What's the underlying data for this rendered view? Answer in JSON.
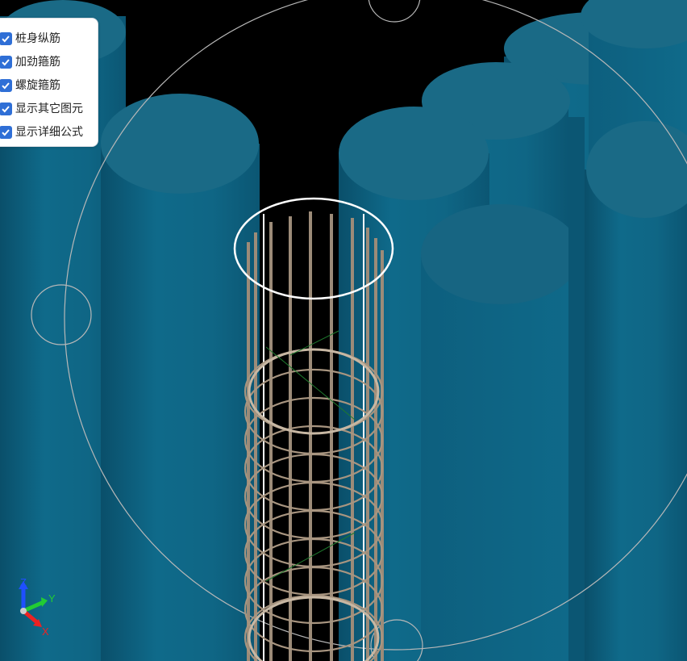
{
  "layer_panel": {
    "items": [
      {
        "label": "桩身纵筋",
        "checked": true
      },
      {
        "label": "加劲箍筋",
        "checked": true
      },
      {
        "label": "螺旋箍筋",
        "checked": true
      },
      {
        "label": "显示其它图元",
        "checked": true
      },
      {
        "label": "显示详细公式",
        "checked": true
      }
    ],
    "check_color": "#2f6fd6"
  },
  "scene": {
    "background_color": "#000000",
    "pile_color": "#0f6685",
    "pile_top_color": "#1a6a86",
    "rebar_color": "#9c8b78",
    "highlight_color": "#ffffff",
    "reference_circle_color": "#b8b8b8"
  },
  "axis_gizmo": {
    "labels": {
      "z": "Z",
      "y": "Y",
      "x": "X"
    },
    "colors": {
      "z": "#1f4fff",
      "y": "#22cc33",
      "x": "#ee2222"
    }
  }
}
